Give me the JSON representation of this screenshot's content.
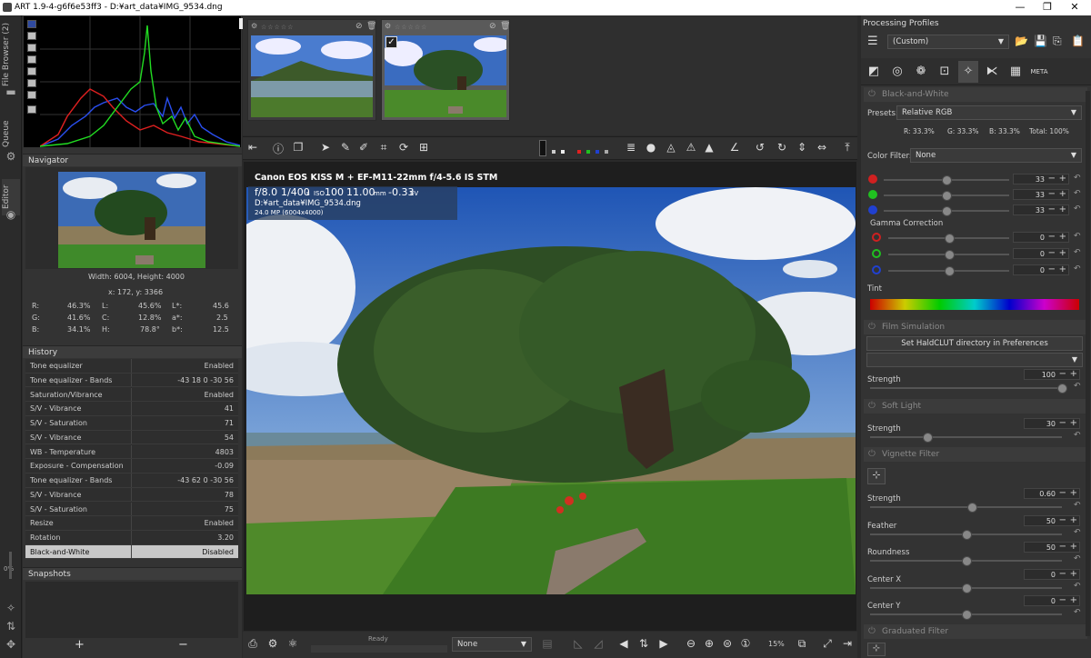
{
  "window": {
    "title": "ART 1.9-4-g6f6e53ff3 - D:¥art_data¥IMG_9534.dng",
    "minimize": "—",
    "maximize": "❐",
    "close": "✕"
  },
  "left_tabs": {
    "file_browser": "File Browser (2)",
    "queue": "Queue",
    "editor": "Editor",
    "progress": "0%"
  },
  "navigator": {
    "title": "Navigator",
    "size_text": "Width: 6004, Height: 4000",
    "coords_text": "x: 172, y: 3366",
    "readouts": [
      {
        "l1": "R:",
        "v1": "46.3%",
        "l2": "L:",
        "v2": "45.6%",
        "l3": "L*:",
        "v3": "45.6"
      },
      {
        "l1": "G:",
        "v1": "41.6%",
        "l2": "C:",
        "v2": "12.8%",
        "l3": "a*:",
        "v3": "2.5"
      },
      {
        "l1": "B:",
        "v1": "34.1%",
        "l2": "H:",
        "v2": "78.8°",
        "l3": "b*:",
        "v3": "12.5"
      }
    ]
  },
  "history": {
    "title": "History",
    "rows": [
      {
        "k": "Tone equalizer",
        "v": "Enabled"
      },
      {
        "k": "Tone equalizer - Bands",
        "v": "-43 18 0 -30 56"
      },
      {
        "k": "Saturation/Vibrance",
        "v": "Enabled"
      },
      {
        "k": "S/V - Vibrance",
        "v": "41"
      },
      {
        "k": "S/V - Saturation",
        "v": "71"
      },
      {
        "k": "S/V - Vibrance",
        "v": "54"
      },
      {
        "k": "WB - Temperature",
        "v": "4803"
      },
      {
        "k": "Exposure - Compensation",
        "v": "-0.09"
      },
      {
        "k": "Tone equalizer - Bands",
        "v": "-43 62 0 -30 56"
      },
      {
        "k": "S/V - Vibrance",
        "v": "78"
      },
      {
        "k": "S/V - Saturation",
        "v": "75"
      },
      {
        "k": "Resize",
        "v": "Enabled"
      },
      {
        "k": "Rotation",
        "v": "3.20"
      },
      {
        "k": "Black-and-White",
        "v": "Disabled"
      }
    ]
  },
  "snapshots": {
    "title": "Snapshots",
    "add": "+",
    "remove": "−"
  },
  "viewer": {
    "camera": "Canon EOS KISS M + EF-M11-22mm f/4-5.6 IS STM",
    "aperture": "f/8.0",
    "shutter": "1/400",
    "shutter_unit": "s",
    "iso_label": "ISO",
    "iso": "100",
    "focal": "11.00",
    "focal_unit": "mm",
    "ev": "-0.33",
    "ev_unit": "EV",
    "path": "D:¥art_data¥IMG_9534.dng",
    "mp": "24.0 MP (6004x4000)"
  },
  "bottom": {
    "status": "Ready",
    "profile_combo": "None",
    "zoom": "15%"
  },
  "right": {
    "processing_profiles": "Processing Profiles",
    "profile_value": "(Custom)",
    "bw": {
      "title": "Black-and-White",
      "presets_label": "Presets:",
      "presets_value": "Relative RGB",
      "summary_r": "R: 33.3%",
      "summary_g": "G: 33.3%",
      "summary_b": "B: 33.3%",
      "summary_total": "Total: 100%",
      "color_filter_label": "Color Filter:",
      "color_filter_value": "None",
      "mixer": [
        "33",
        "33",
        "33"
      ],
      "mixer_levels": [
        0.5,
        0.5,
        0.5
      ],
      "gamma_label": "Gamma Correction",
      "gamma": [
        "0",
        "0",
        "0"
      ],
      "gamma_levels": [
        0.5,
        0.5,
        0.5
      ],
      "tint_label": "Tint"
    },
    "film": {
      "title": "Film Simulation",
      "haldclut_button": "Set HaldCLUT directory in Preferences",
      "strength_label": "Strength",
      "strength": "100",
      "strength_level": 1.0
    },
    "softlight": {
      "title": "Soft Light",
      "strength_label": "Strength",
      "strength": "30",
      "strength_level": 0.3
    },
    "vignette": {
      "title": "Vignette Filter",
      "rows": [
        {
          "label": "Strength",
          "value": "0.60",
          "level": 0.53
        },
        {
          "label": "Feather",
          "value": "50",
          "level": 0.5
        },
        {
          "label": "Roundness",
          "value": "50",
          "level": 0.5
        },
        {
          "label": "Center X",
          "value": "0",
          "level": 0.5
        },
        {
          "label": "Center Y",
          "value": "0",
          "level": 0.5
        }
      ]
    },
    "graduated": {
      "title": "Graduated Filter"
    },
    "meta_tab": "META"
  },
  "colors": {
    "accent_red": "#d02020",
    "accent_green": "#20c020",
    "accent_blue": "#2040d0"
  }
}
